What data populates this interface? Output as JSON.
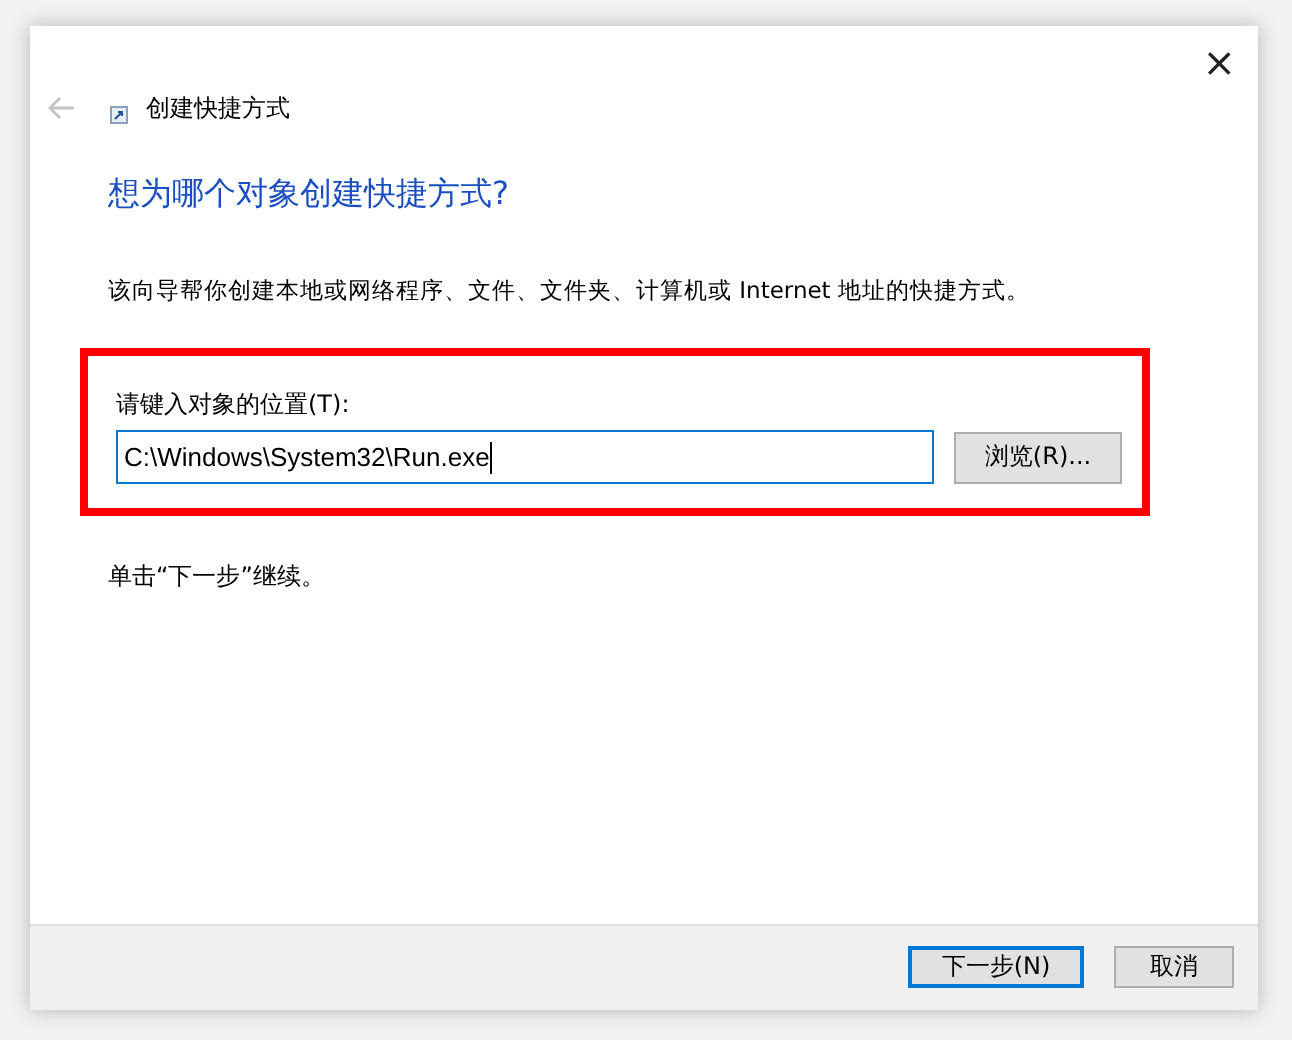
{
  "window": {
    "title": "创建快捷方式",
    "close": "×"
  },
  "heading": "想为哪个对象创建快捷方式?",
  "description": "该向导帮你创建本地或网络程序、文件、文件夹、计算机或 Internet 地址的快捷方式。",
  "location": {
    "label": "请键入对象的位置(T):",
    "value": "C:\\Windows\\System32\\Run.exe",
    "highlighted": true
  },
  "browse_button": "浏览(R)...",
  "hint": "单击“下一步”继续。",
  "buttons": [
    {
      "label": "下一步(N)",
      "default": true
    },
    {
      "label": "取消",
      "default": false
    }
  ]
}
